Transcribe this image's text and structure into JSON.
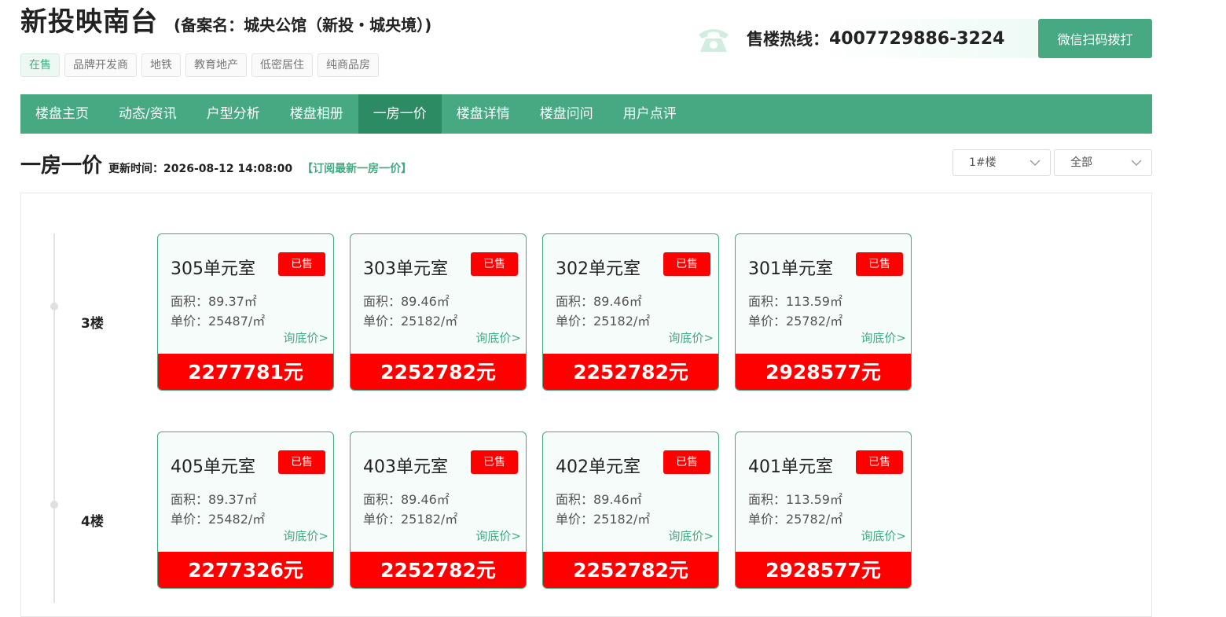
{
  "header": {
    "title": "新投映南台",
    "subtitle": "(备案名：城央公馆（新投・城央境）)",
    "tags": [
      "在售",
      "品牌开发商",
      "地铁",
      "教育地产",
      "低密居住",
      "纯商品房"
    ],
    "hotline_label": "售楼热线：",
    "hotline_number": "4007729886-3224",
    "call_button": "微信扫码拨打"
  },
  "nav": {
    "items": [
      "楼盘主页",
      "动态/资讯",
      "户型分析",
      "楼盘相册",
      "一房一价",
      "楼盘详情",
      "楼盘问问",
      "用户点评"
    ],
    "active": "一房一价"
  },
  "section": {
    "title": "一房一价",
    "update_label": "更新时间：",
    "update_time": "2026-08-12 14:08:00",
    "subscribe": "【订阅最新一房一价】",
    "building_select": "1#楼",
    "status_select": "全部"
  },
  "floors": [
    {
      "label": "3楼",
      "units": [
        {
          "room": "305单元室",
          "status": "已售",
          "area": "面积：89.37㎡",
          "unit_price": "单价：25487/㎡",
          "inquire": "询底价>",
          "total": "2277781元"
        },
        {
          "room": "303单元室",
          "status": "已售",
          "area": "面积：89.46㎡",
          "unit_price": "单价：25182/㎡",
          "inquire": "询底价>",
          "total": "2252782元"
        },
        {
          "room": "302单元室",
          "status": "已售",
          "area": "面积：89.46㎡",
          "unit_price": "单价：25182/㎡",
          "inquire": "询底价>",
          "total": "2252782元"
        },
        {
          "room": "301单元室",
          "status": "已售",
          "area": "面积：113.59㎡",
          "unit_price": "单价：25782/㎡",
          "inquire": "询底价>",
          "total": "2928577元"
        }
      ]
    },
    {
      "label": "4楼",
      "units": [
        {
          "room": "405单元室",
          "status": "已售",
          "area": "面积：89.37㎡",
          "unit_price": "单价：25482/㎡",
          "inquire": "询底价>",
          "total": "2277326元"
        },
        {
          "room": "403单元室",
          "status": "已售",
          "area": "面积：89.46㎡",
          "unit_price": "单价：25182/㎡",
          "inquire": "询底价>",
          "total": "2252782元"
        },
        {
          "room": "402单元室",
          "status": "已售",
          "area": "面积：89.46㎡",
          "unit_price": "单价：25182/㎡",
          "inquire": "询底价>",
          "total": "2252782元"
        },
        {
          "room": "401单元室",
          "status": "已售",
          "area": "面积：113.59㎡",
          "unit_price": "单价：25782/㎡",
          "inquire": "询底价>",
          "total": "2928577元"
        }
      ]
    }
  ],
  "colors": {
    "brand_green": "#46a982",
    "nav_active": "#2c8b63",
    "sold_red": "#ff0000"
  },
  "icons": {
    "hotline": "phone-icon",
    "select": "chevron-down-icon"
  }
}
